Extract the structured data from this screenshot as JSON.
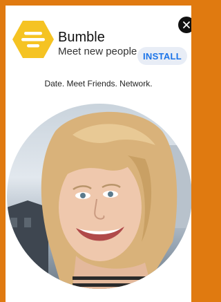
{
  "app": {
    "name": "Bumble",
    "subtitle": "Meet new people",
    "install_label": "INSTALL",
    "tagline": "Date. Meet Friends. Network."
  },
  "icons": {
    "close": "close-icon",
    "logo": "bumble-logo"
  },
  "colors": {
    "brand_yellow": "#F5C323",
    "frame_orange": "#E07A10",
    "install_text": "#1A73E8",
    "install_bg": "#E8EDF6"
  }
}
